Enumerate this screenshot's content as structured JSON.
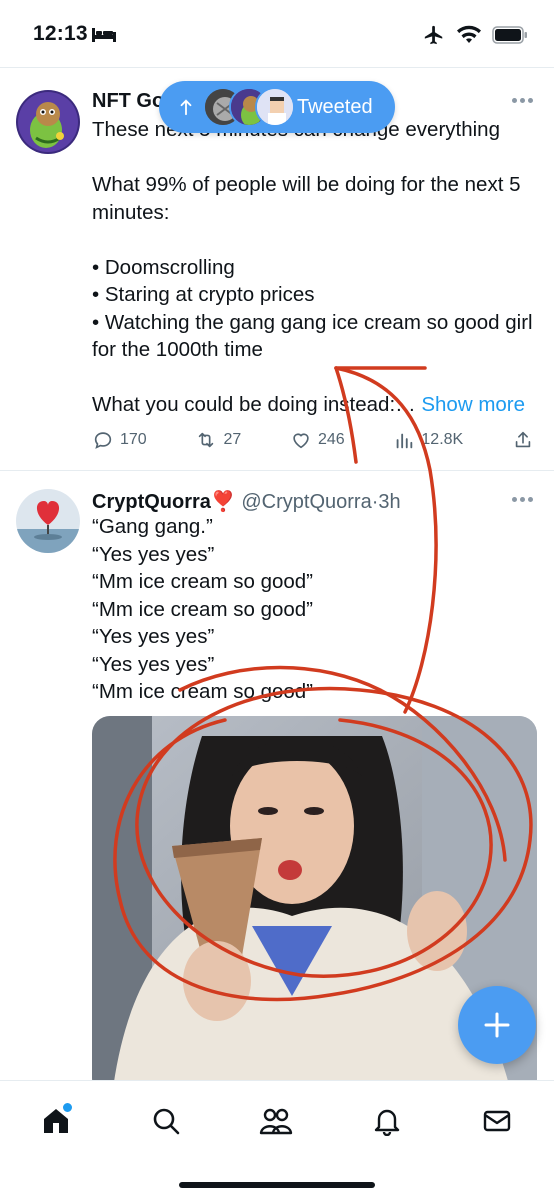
{
  "status_bar": {
    "time": "12:13",
    "icons": [
      "bed-icon",
      "airplane-icon",
      "wifi-icon",
      "battery-icon"
    ]
  },
  "tweet1": {
    "author_name": "NFT Go",
    "text": "These next 5 minutes can change everything\n\nWhat 99% of people will be doing for the next 5 minutes:\n\n• Doomscrolling\n• Staring at crypto prices\n• Watching the gang gang ice cream so good girl for the 1000th time\n\nWhat you could be doing instead:… ",
    "show_more": "Show more",
    "replies": "170",
    "retweets": "27",
    "likes": "246",
    "views": "12.8K"
  },
  "new_tweets_pill": {
    "label": "Tweeted"
  },
  "tweet2": {
    "author_name": "CryptQuorra",
    "emoji": "❣️",
    "handle": "@CryptQuorra",
    "separator": "·",
    "time": "3h",
    "text": "“Gang gang.”\n“Yes yes yes”\n“Mm ice cream so good”\n“Mm ice cream so good”\n“Yes yes yes”\n“Yes yes yes”\n“Mm ice cream so good”"
  },
  "fab": {
    "icon": "plus-icon"
  },
  "tab_bar": {
    "items": [
      "home-icon",
      "search-icon",
      "communities-icon",
      "notifications-icon",
      "messages-icon"
    ]
  },
  "colors": {
    "accent": "#1d9bf0",
    "pill": "#4b9cf2",
    "text": "#0f1419",
    "muted": "#536471",
    "annotation": "#d13b1f"
  }
}
